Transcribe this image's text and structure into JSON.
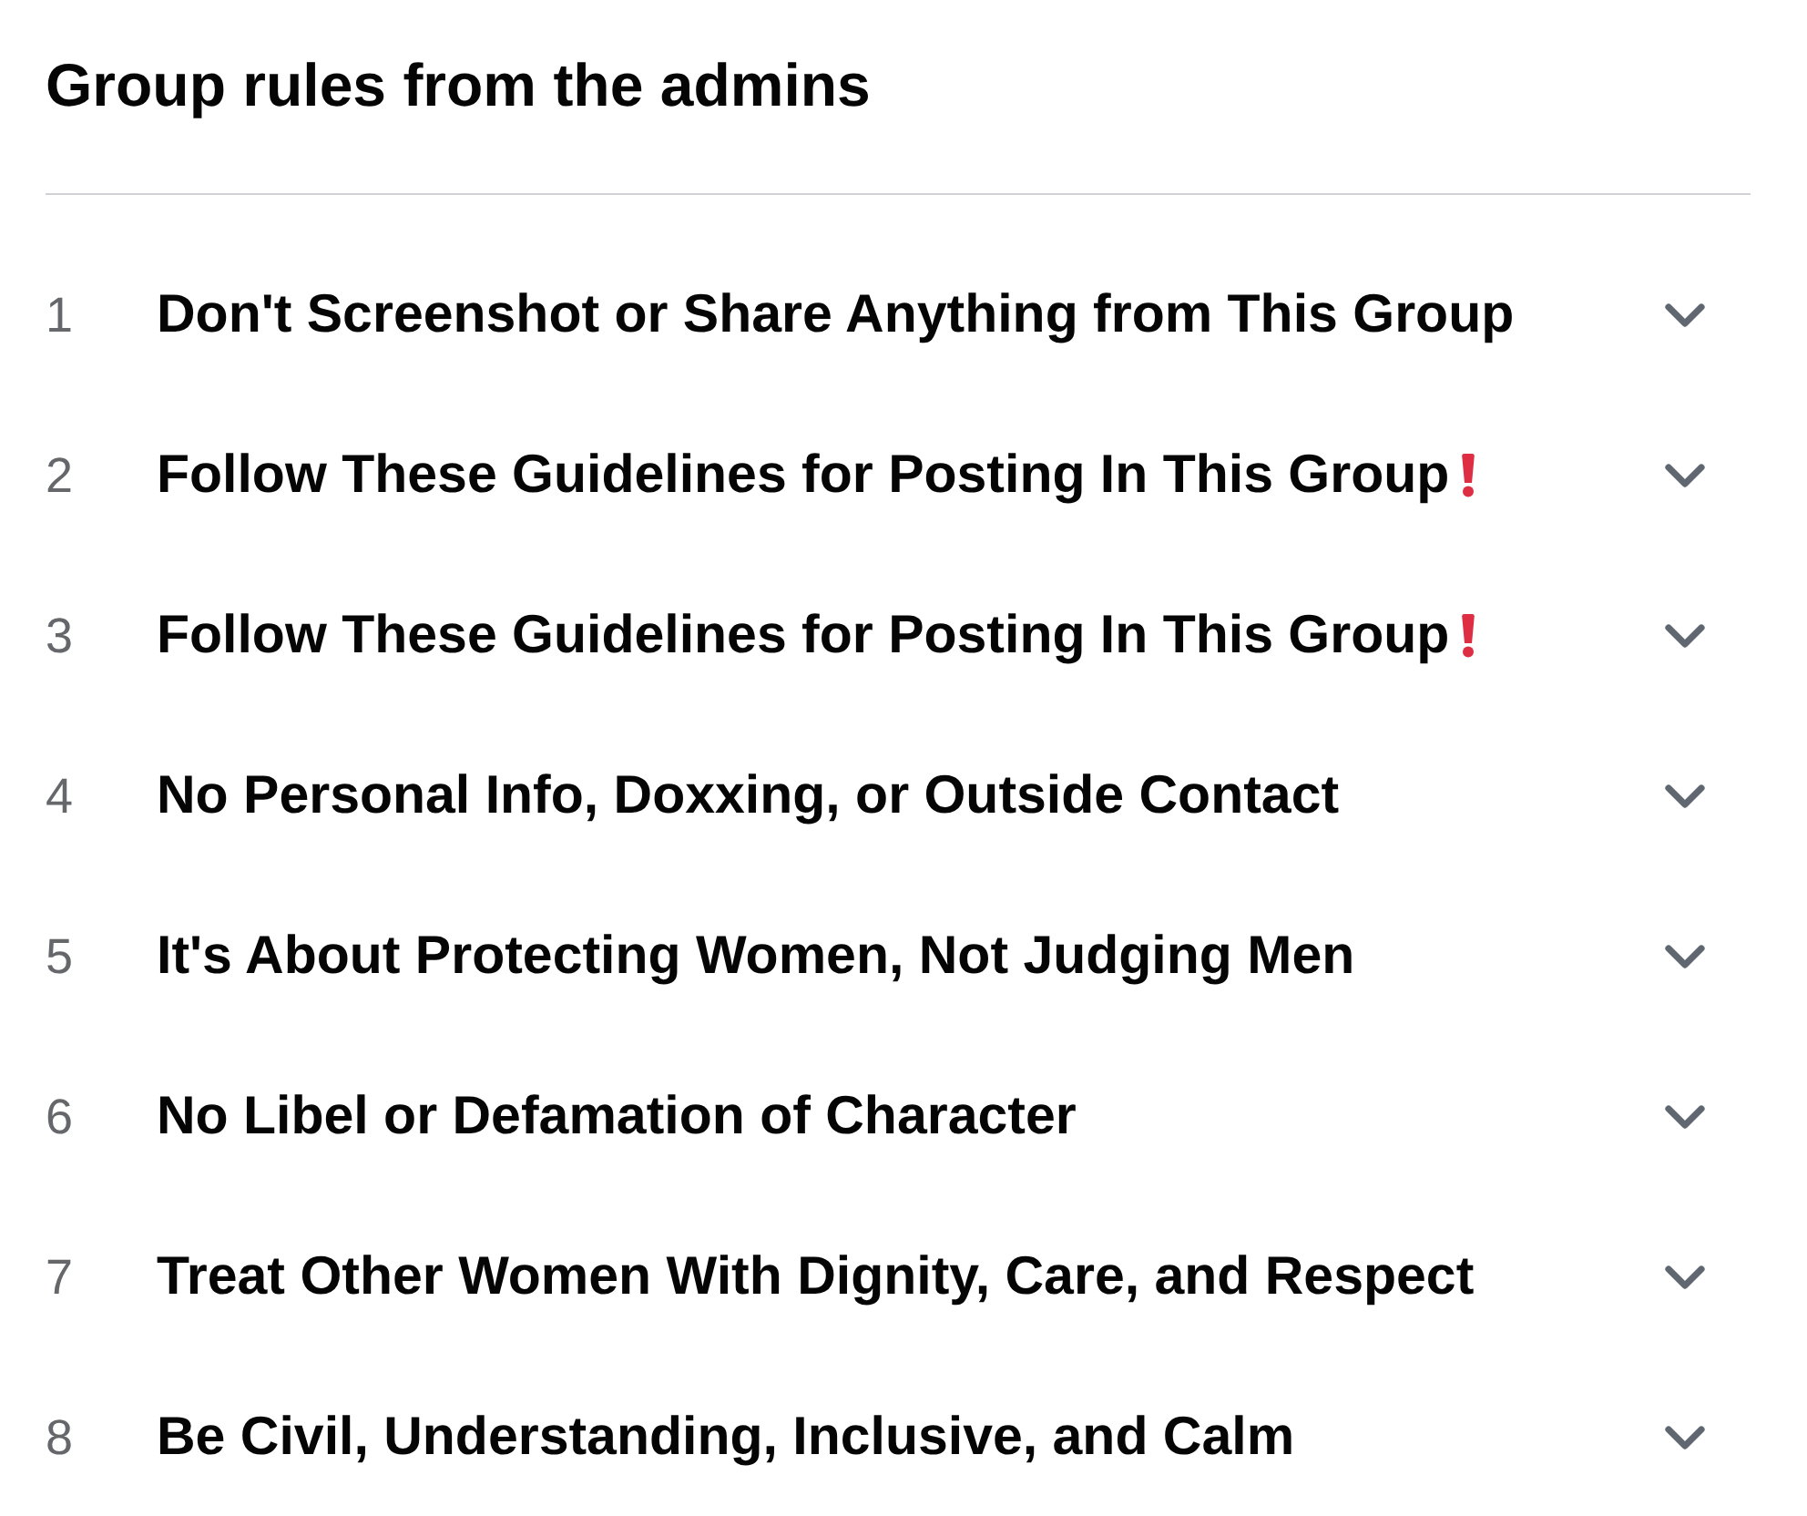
{
  "title": "Group rules from the admins",
  "rules": [
    {
      "number": "1",
      "title": "Don't Screenshot or Share Anything from This Group",
      "exclamation_mark": false,
      "expanded": false
    },
    {
      "number": "2",
      "title": "Follow These Guidelines for Posting In This Group",
      "exclamation_mark": true,
      "expanded": false
    },
    {
      "number": "3",
      "title": "Follow These Guidelines for Posting In This Group",
      "exclamation_mark": true,
      "expanded": false
    },
    {
      "number": "4",
      "title": "No Personal Info, Doxxing, or Outside Contact",
      "exclamation_mark": false,
      "expanded": false
    },
    {
      "number": "5",
      "title": "It's About Protecting Women, Not Judging Men",
      "exclamation_mark": false,
      "expanded": false
    },
    {
      "number": "6",
      "title": "No Libel or Defamation of Character",
      "exclamation_mark": false,
      "expanded": false
    },
    {
      "number": "7",
      "title": "Treat Other Women With Dignity, Care, and Respect",
      "exclamation_mark": false,
      "expanded": false
    },
    {
      "number": "8",
      "title": "Be Civil, Understanding, Inclusive, and Calm",
      "exclamation_mark": false,
      "expanded": false
    }
  ]
}
